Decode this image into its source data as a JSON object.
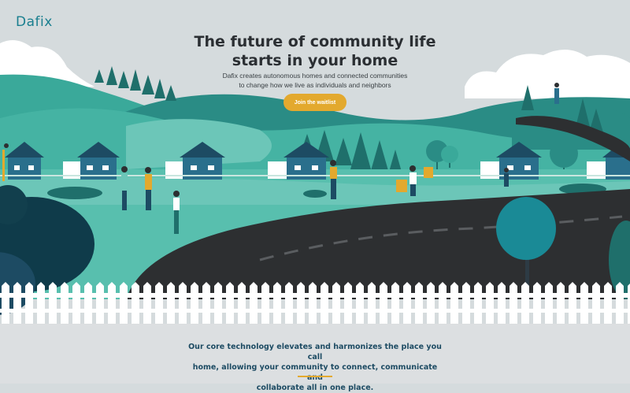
{
  "brand": {
    "logo_text": "Dafix"
  },
  "hero": {
    "title_line1": "The future of community life",
    "title_line2": "starts in your home",
    "subtitle_line1": "Dafix creates autonomous homes and connected communities",
    "subtitle_line2": "to change how we live as individuals and neighbors",
    "cta_label": "Join the waitlist"
  },
  "mission": {
    "line1": "Our core technology elevates and harmonizes the place you call",
    "line2": "home, allowing your community to connect, communicate and",
    "line3": "collaborate all in one place."
  },
  "colors": {
    "accent": "#e3a92e",
    "teal_dark": "#1f6f6b",
    "teal": "#3aa99a",
    "mint": "#6cc6b8",
    "road": "#2d2f31",
    "sky": "#d5dbdd",
    "text_dark": "#2b2f33",
    "navy": "#1d4b63"
  }
}
